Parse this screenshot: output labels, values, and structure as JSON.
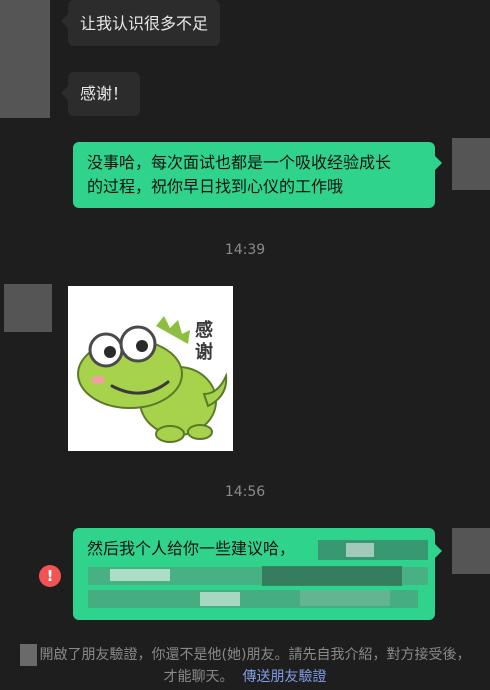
{
  "messages": [
    {
      "side": "in",
      "text": "让我认识很多不足"
    },
    {
      "side": "in",
      "text": "感谢！"
    },
    {
      "side": "out",
      "line1": "没事哈，每次面试也都是一个吸收经验成长",
      "line2": "的过程，祝你早日找到心仪的工作哦"
    },
    {
      "side": "in",
      "type": "sticker",
      "sticker_text": "感谢"
    },
    {
      "side": "out",
      "line1": "然后我个人给你一些建议哈，",
      "status": "send-failed"
    }
  ],
  "timestamps": [
    "14:39",
    "14:56"
  ],
  "error_icon_glyph": "!",
  "notice": {
    "line1": "開啟了朋友驗證，你還不是他(她)朋友。請先自我介紹，對方接受後，",
    "line2_text": "才能聊天。",
    "link": "傳送朋友驗證"
  },
  "colors": {
    "background": "#1e1e1e",
    "bubble_in": "#2c2c2c",
    "bubble_out": "#2fd38c",
    "error": "#f25454",
    "link": "#7f9ce6"
  }
}
